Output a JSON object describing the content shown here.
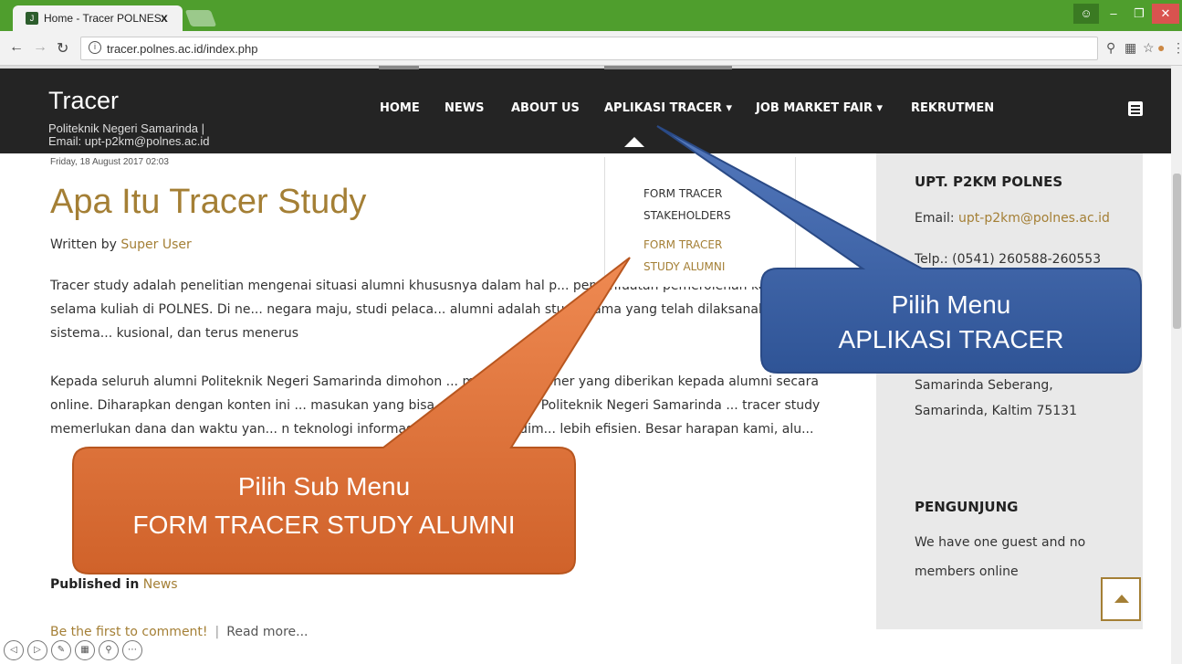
{
  "browser": {
    "tab_title": "Home - Tracer POLNES",
    "tab_close": "x",
    "url": "tracer.polnes.ac.id/index.php"
  },
  "site": {
    "title": "Tracer",
    "subtitle_line1": "Politeknik Negeri Samarinda |",
    "subtitle_line2": "Email: upt-p2km@polnes.ac.id",
    "menu": [
      "HOME",
      "NEWS",
      "ABOUT US",
      "APLIKASI TRACER ▾",
      "JOB MARKET FAIR ▾",
      "REKRUTMEN"
    ]
  },
  "dropdown": {
    "items": [
      "FORM TRACER",
      "STAKEHOLDERS",
      "FORM TRACER",
      "STUDY ALUMNI"
    ]
  },
  "article": {
    "date": "Friday, 18 August 2017 02:03",
    "title": "Apa Itu Tracer Study",
    "written_by": "Written by",
    "author": "Super User",
    "para1": "Tracer study adalah penelitian mengenai situasi alumni khususnya dalam hal p... pemanfaatan pemerolehan kompetensi selama kuliah di POLNES. Di ne... negara maju, studi pelaca... alumni adalah studi utama yang telah dilaksanakan secara sistema... kusional, dan terus menerus",
    "para2": "Kepada seluruh alumni Politeknik Negeri Samarinda dimohon ... mengisi kuisioner yang diberikan kepada alumni secara online. Diharapkan dengan konten ini ... masukan yang bisa digunakan oleh Politeknik Negeri Samarinda ... tracer study memerlukan dana dan waktu yan... n teknologi informasi seperti saat ini dim... lebih efisien. Besar harapan kami, alu...",
    "published_in": "Published in",
    "category": "News",
    "comment_link": "Be the first to comment!",
    "read_more": "Read more..."
  },
  "sidebar": {
    "heading1": "UPT. P2KM POLNES",
    "email_label": "Email:",
    "email": "upt-p2km@polnes.ac.id",
    "telp": "Telp.: (0541) 260588-260553",
    "address1": "Samarinda Seberang,",
    "address2": "Samarinda, Kaltim 75131",
    "heading2": "PENGUNJUNG",
    "visitors1": "We have one guest and no",
    "visitors2": "members online"
  },
  "callouts": {
    "blue_line1": "Pilih Menu",
    "blue_line2": "APLIKASI TRACER",
    "orange_line1": "Pilih Sub Menu",
    "orange_line2": "FORM TRACER STUDY ALUMNI"
  },
  "colors": {
    "accent": "#a47f35",
    "header_bg": "#242424",
    "callout_blue": "#3f66a8",
    "callout_orange": "#e0743a"
  }
}
